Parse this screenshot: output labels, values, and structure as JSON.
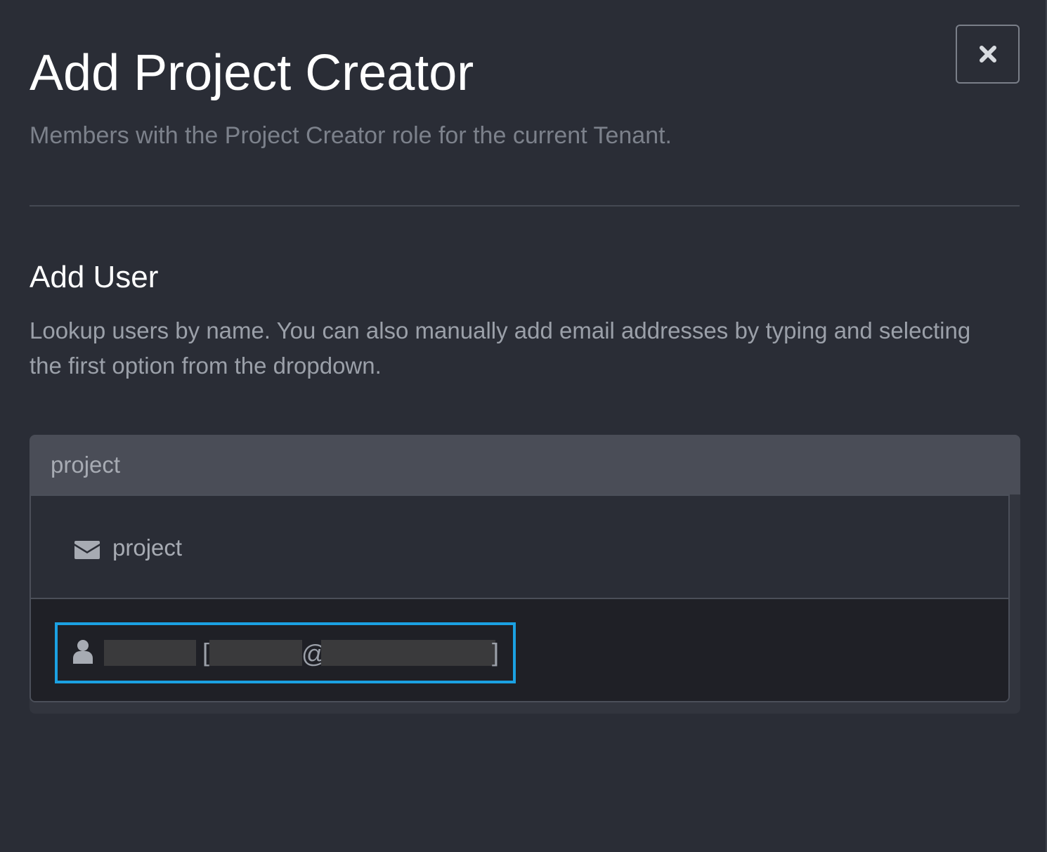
{
  "dialog": {
    "title": "Add Project Creator",
    "subtitle": "Members with the Project Creator role for the current Tenant.",
    "close_icon": "close-icon"
  },
  "add_user": {
    "heading": "Add User",
    "help_text": "Lookup users by name. You can also manually add email addresses by typing and selecting the first option from the dropdown.",
    "search_value": "project"
  },
  "dropdown": {
    "options": [
      {
        "icon": "envelope-icon",
        "label": "project"
      },
      {
        "icon": "user-icon",
        "open_bracket": "[",
        "at": "@",
        "close_bracket": "]"
      }
    ]
  },
  "colors": {
    "background": "#2a2d36",
    "input_background": "#4a4d57",
    "highlight_option": "#1f2026",
    "focus_ring": "#1ba1e2"
  }
}
